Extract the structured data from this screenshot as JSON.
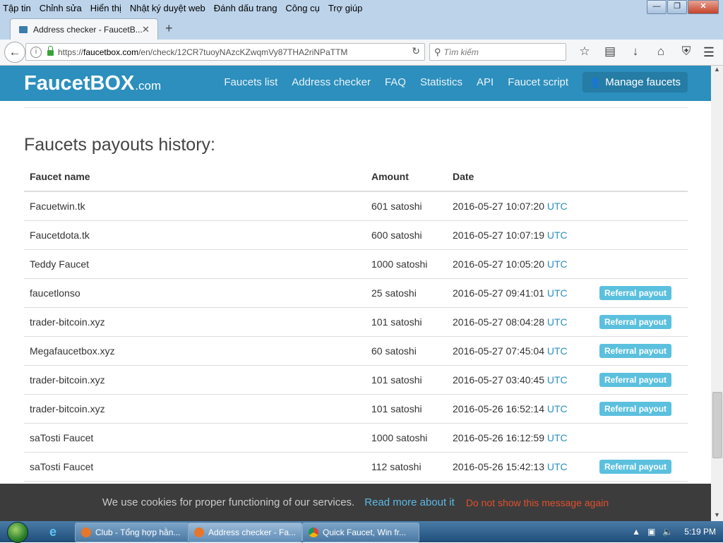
{
  "menubar": {
    "items": [
      "Tập tin",
      "Chỉnh sửa",
      "Hiển thị",
      "Nhật ký duyệt web",
      "Đánh dấu trang",
      "Công cụ",
      "Trợ giúp"
    ]
  },
  "browser": {
    "tab_title": "Address checker - FaucetB...",
    "url_prefix": "https://",
    "url_host": "faucetbox.com",
    "url_path": "/en/check/12CR7tuoyNAzcKZwqmVy87THA2riNPaTTM",
    "search_placeholder": "Tìm kiếm"
  },
  "site": {
    "logo_main": "FaucetBOX",
    "logo_suffix": ".com",
    "nav": [
      "Faucets list",
      "Address checker",
      "FAQ",
      "Statistics",
      "API",
      "Faucet script"
    ],
    "manage_label": "Manage faucets"
  },
  "main": {
    "title": "Faucets payouts history:",
    "columns": [
      "Faucet name",
      "Amount",
      "Date"
    ],
    "rows": [
      {
        "name": "Facuetwin.tk",
        "amount": "601 satoshi",
        "date": "2016-05-27 10:07:20",
        "tz": "UTC",
        "badge": ""
      },
      {
        "name": "Faucetdota.tk",
        "amount": "600 satoshi",
        "date": "2016-05-27 10:07:19",
        "tz": "UTC",
        "badge": ""
      },
      {
        "name": "Teddy Faucet",
        "amount": "1000 satoshi",
        "date": "2016-05-27 10:05:20",
        "tz": "UTC",
        "badge": ""
      },
      {
        "name": "faucetlonso",
        "amount": "25 satoshi",
        "date": "2016-05-27 09:41:01",
        "tz": "UTC",
        "badge": "Referral payout"
      },
      {
        "name": "trader-bitcoin.xyz",
        "amount": "101 satoshi",
        "date": "2016-05-27 08:04:28",
        "tz": "UTC",
        "badge": "Referral payout"
      },
      {
        "name": "Megafaucetbox.xyz",
        "amount": "60 satoshi",
        "date": "2016-05-27 07:45:04",
        "tz": "UTC",
        "badge": "Referral payout"
      },
      {
        "name": "trader-bitcoin.xyz",
        "amount": "101 satoshi",
        "date": "2016-05-27 03:40:45",
        "tz": "UTC",
        "badge": "Referral payout"
      },
      {
        "name": "trader-bitcoin.xyz",
        "amount": "101 satoshi",
        "date": "2016-05-26 16:52:14",
        "tz": "UTC",
        "badge": "Referral payout"
      },
      {
        "name": "saTosti Faucet",
        "amount": "1000 satoshi",
        "date": "2016-05-26 16:12:59",
        "tz": "UTC",
        "badge": ""
      },
      {
        "name": "saTosti Faucet",
        "amount": "112 satoshi",
        "date": "2016-05-26 15:42:13",
        "tz": "UTC",
        "badge": "Referral payout"
      }
    ]
  },
  "cookie": {
    "message": "We use cookies for proper functioning of our services.",
    "read_more": "Read more about it",
    "dismiss": "Do not show this message again"
  },
  "taskbar": {
    "buttons": [
      "Club - Tổng hợp hằn...",
      "Address checker - Fa...",
      "Quick Faucet, Win fr..."
    ],
    "clock": "5:19 PM"
  },
  "colors": {
    "brand": "#2c8fbd",
    "badge": "#5bc0de",
    "cookie_link": "#5bb9e6",
    "cookie_dismiss": "#e0502e"
  }
}
